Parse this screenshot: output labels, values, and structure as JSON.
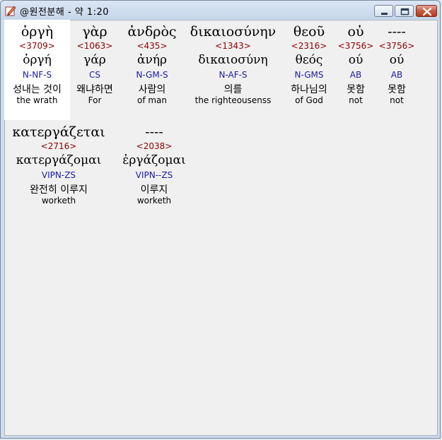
{
  "window": {
    "title": "@원전분해 - 약 1:20",
    "icon": "pen-icon",
    "controls": [
      "minimize-icon",
      "maximize-icon",
      "close-icon"
    ]
  },
  "words": [
    {
      "greek": "ὀργὴ",
      "strong": "<3709>",
      "lemma": "ὀργή",
      "morph": "N-NF-S",
      "korean": "성내는 것이",
      "english": "the wrath"
    },
    {
      "greek": "γὰρ",
      "strong": "<1063>",
      "lemma": "γάρ",
      "morph": "CS",
      "korean": "왜냐하면",
      "english": "For"
    },
    {
      "greek": "ἀνδρὸς",
      "strong": "<435>",
      "lemma": "ἀνήρ",
      "morph": "N-GM-S",
      "korean": "사람의",
      "english": "of man"
    },
    {
      "greek": "δικαιοσύνην",
      "strong": "<1343>",
      "lemma": "δικαιοσύνη",
      "morph": "N-AF-S",
      "korean": "의를",
      "english": "the righteousenss"
    },
    {
      "greek": "θεοῦ",
      "strong": "<2316>",
      "lemma": "θεός",
      "morph": "N-GMS",
      "korean": "하나님의",
      "english": "of God"
    },
    {
      "greek": "οὐ",
      "strong": "<3756>",
      "lemma": "ού",
      "morph": "AB",
      "korean": "못함",
      "english": "not"
    },
    {
      "greek": "----",
      "strong": "<3756>",
      "lemma": "ού",
      "morph": "AB",
      "korean": "못함",
      "english": "not"
    },
    {
      "greek": "κατεργάζεται",
      "strong": "<2716>",
      "lemma": "κατεργάζομαι",
      "morph": "VIPN-ZS",
      "korean": "완전히 이루지",
      "english": "worketh"
    },
    {
      "greek": "----",
      "strong": "<2038>",
      "lemma": "ἐργάζομαι",
      "morph": "VIPN--ZS",
      "korean": "이루지",
      "english": "worketh"
    }
  ]
}
